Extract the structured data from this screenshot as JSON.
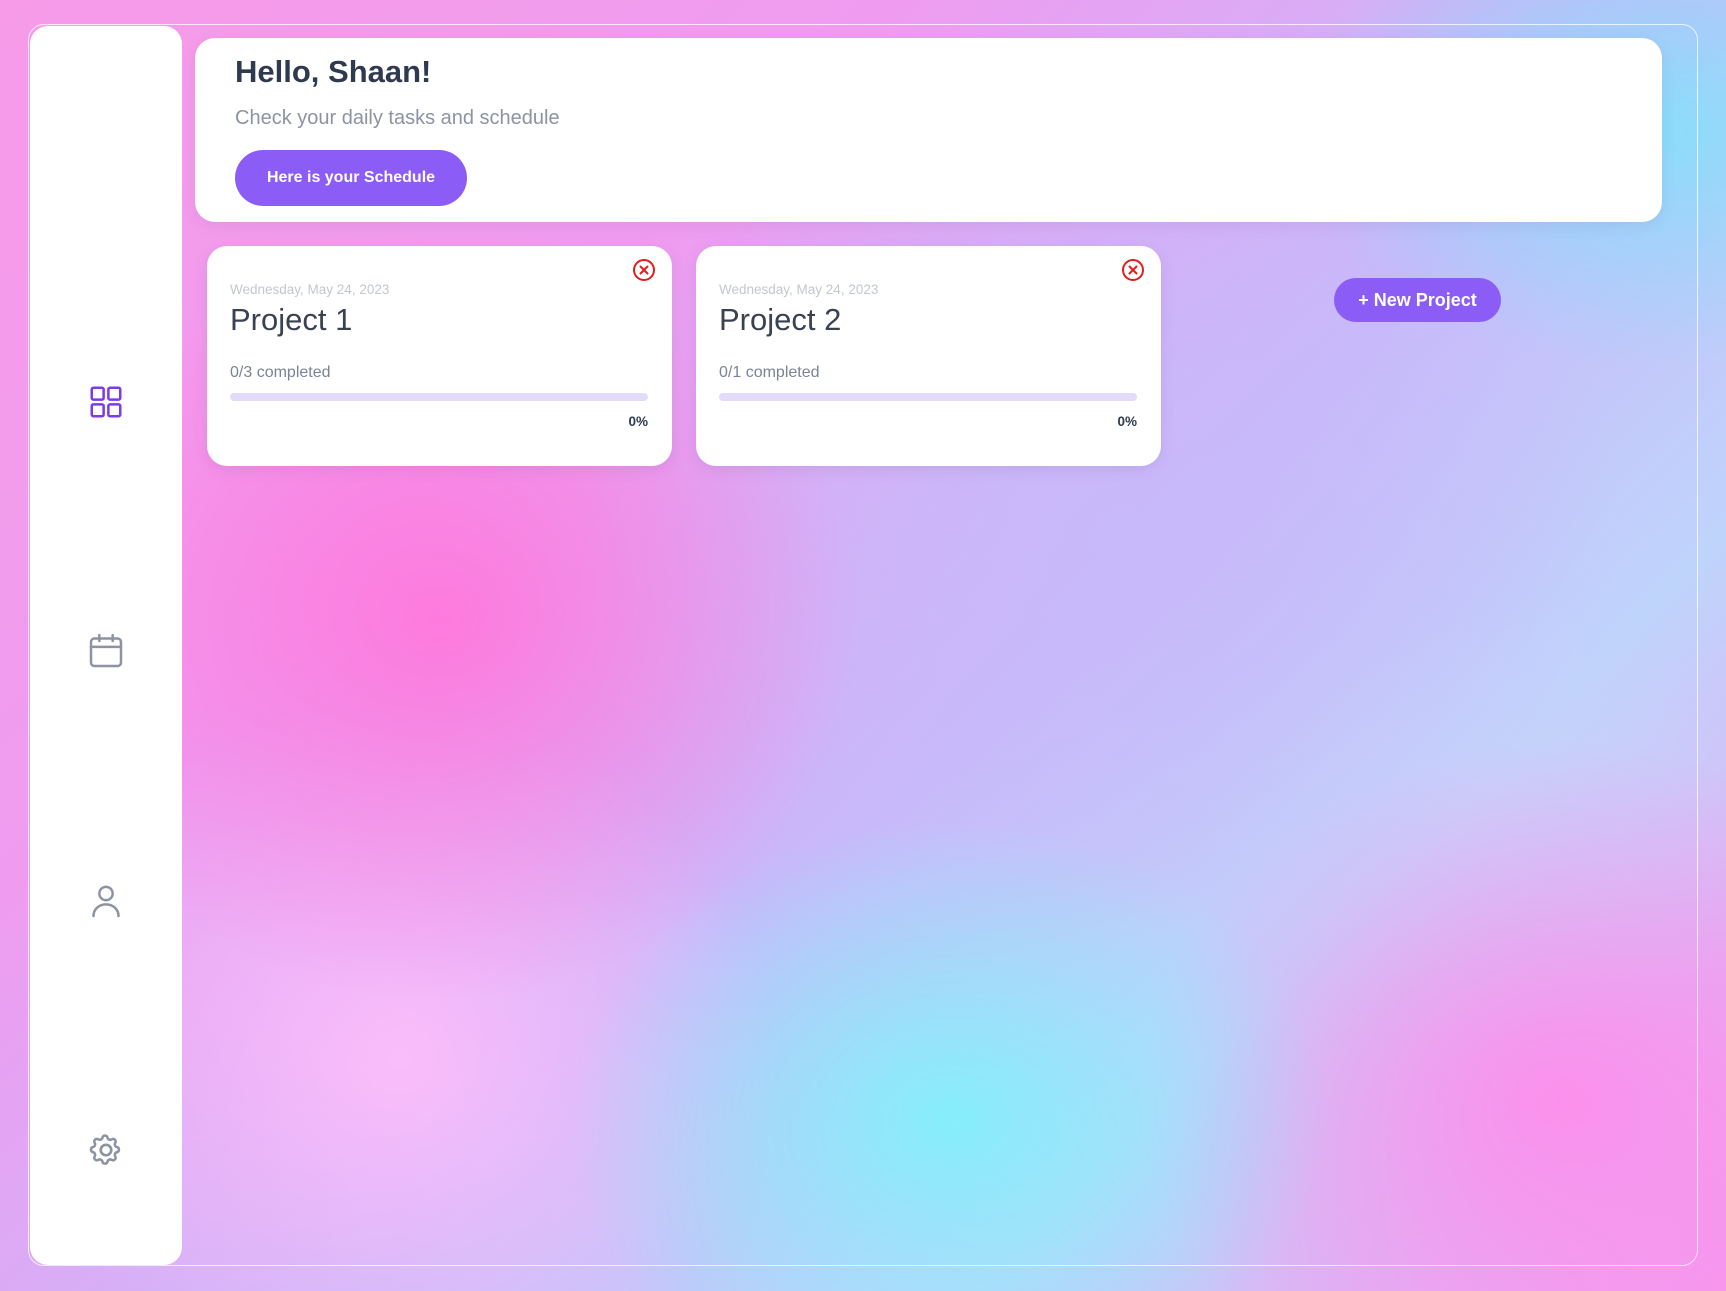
{
  "sidebar": {
    "items": [
      {
        "icon": "grid-icon",
        "active": true
      },
      {
        "icon": "calendar-icon",
        "active": false
      },
      {
        "icon": "user-icon",
        "active": false
      },
      {
        "icon": "gear-icon",
        "active": false
      }
    ]
  },
  "header": {
    "greeting": "Hello, Shaan!",
    "subtitle": "Check your daily tasks and schedule",
    "schedule_button_label": "Here is your Schedule"
  },
  "projects": [
    {
      "date": "Wednesday, May 24, 2023",
      "title": "Project 1",
      "progress_text": "0/3 completed",
      "progress_fraction": 0,
      "percent_label": "0%"
    },
    {
      "date": "Wednesday, May 24, 2023",
      "title": "Project 2",
      "progress_text": "0/1 completed",
      "progress_fraction": 0,
      "percent_label": "0%"
    }
  ],
  "new_project_button_label": "+ New Project",
  "colors": {
    "accent": "#8b5cf6",
    "active_icon": "#7c3aed",
    "inactive_icon": "#8d93a3",
    "delete": "#e11d1d",
    "progress_track": "#e2dcfa"
  }
}
